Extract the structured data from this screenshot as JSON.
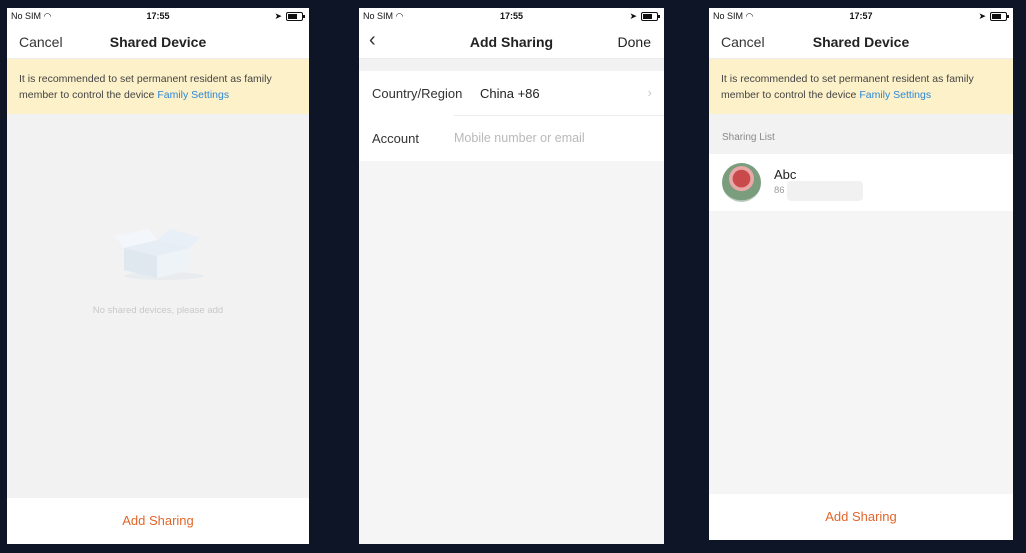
{
  "status_bar": {
    "carrier": "No SIM",
    "screen1_time": "17:55",
    "screen2_time": "17:55",
    "screen3_time": "17:57"
  },
  "screen1": {
    "nav_left": "Cancel",
    "title": "Shared Device",
    "banner_text": "It is recommended to set permanent resident as family member to control the device",
    "banner_link": "Family Settings",
    "empty_text": "No shared devices, please add",
    "bottom_button": "Add Sharing"
  },
  "screen2": {
    "title": "Add Sharing",
    "nav_right": "Done",
    "rows": [
      {
        "label": "Country/Region",
        "value": "China +86"
      },
      {
        "label": "Account",
        "placeholder": "Mobile number or email"
      }
    ]
  },
  "screen3": {
    "nav_left": "Cancel",
    "title": "Shared Device",
    "banner_text": "It is recommended to set permanent resident as family member to control the device",
    "banner_link": "Family Settings",
    "section_label": "Sharing List",
    "list": [
      {
        "name": "Abc",
        "sub": "86"
      }
    ],
    "bottom_button": "Add Sharing"
  },
  "colors": {
    "background": "#0e1526",
    "accent_orange": "#e2662b",
    "link_blue": "#2b86d9",
    "banner_bg": "#fdf1c9"
  },
  "icons": [
    "wifi-icon",
    "location-arrow-icon",
    "battery-icon",
    "back-chevron-icon",
    "chevron-right-icon",
    "empty-box-icon",
    "avatar"
  ]
}
